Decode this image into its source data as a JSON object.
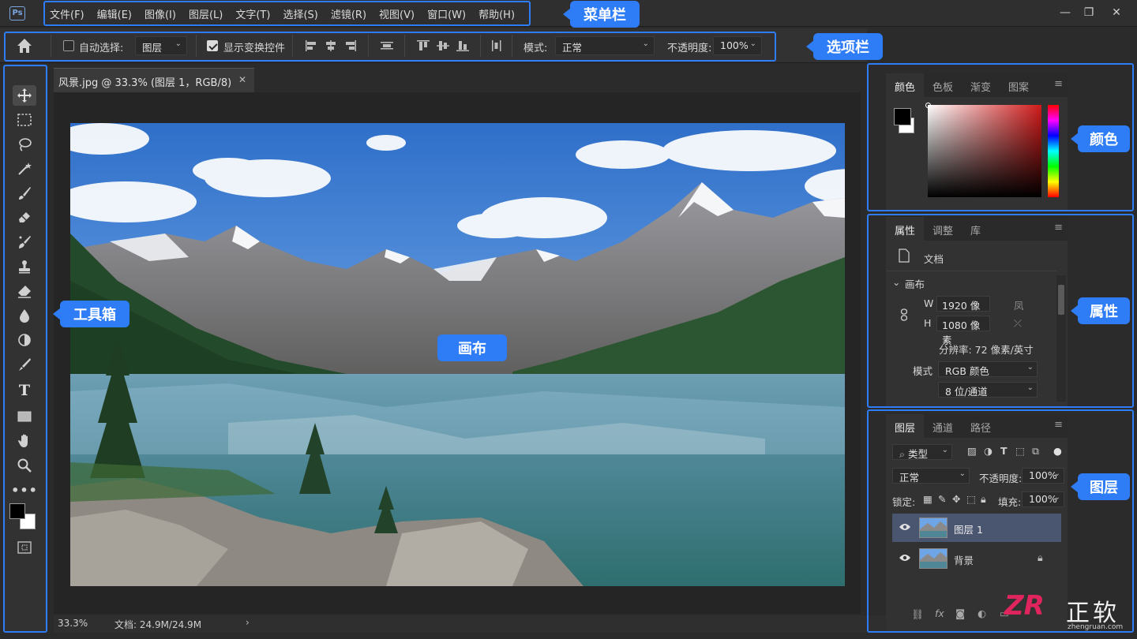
{
  "menubar": {
    "items": [
      "文件(F)",
      "编辑(E)",
      "图像(I)",
      "图层(L)",
      "文字(T)",
      "选择(S)",
      "滤镜(R)",
      "视图(V)",
      "窗口(W)",
      "帮助(H)"
    ]
  },
  "options": {
    "auto_select_label": "自动选择:",
    "auto_select_value": "图层",
    "show_transform_label": "显示变换控件",
    "mode_label": "模式:",
    "mode_value": "正常",
    "opacity_label": "不透明度:",
    "opacity_value": "100%"
  },
  "document": {
    "tab_title": "风景.jpg  @ 33.3% (图层 1，RGB/8)",
    "zoom": "33.3%",
    "doc_size": "文档: 24.9M/24.9M"
  },
  "color_panel": {
    "tabs": [
      "颜色",
      "色板",
      "渐变",
      "图案"
    ],
    "foreground": "#000000",
    "background": "#ffffff",
    "hue_color": "#d11a1a"
  },
  "properties_panel": {
    "tabs": [
      "属性",
      "调整",
      "库"
    ],
    "doc_label": "文档",
    "section_label": "画布",
    "w_label": "W",
    "w_value": "1920 像素",
    "h_label": "H",
    "h_value": "1080 像素",
    "resolution": "分辨率: 72 像素/英寸",
    "mode_label": "模式",
    "mode_value": "RGB 颜色",
    "depth_value": "8 位/通道"
  },
  "layers_panel": {
    "tabs": [
      "图层",
      "通道",
      "路径"
    ],
    "filter_label": "类型",
    "blend_value": "正常",
    "opacity_label": "不透明度:",
    "opacity_value": "100%",
    "lock_label": "锁定:",
    "fill_label": "填充:",
    "fill_value": "100%",
    "layers": [
      {
        "name": "图层 1"
      },
      {
        "name": "背景"
      }
    ]
  },
  "annotations": {
    "menubar": "菜单栏",
    "optionsbar": "选项栏",
    "toolbox": "工具箱",
    "canvas": "画布",
    "color": "颜色",
    "properties": "属性",
    "layers": "图层"
  },
  "colors": {
    "accent": "#2e7cf6",
    "panel_bg": "#323232",
    "app_bg": "#2b2b2b"
  },
  "watermark": {
    "logo": "ZR",
    "cn": "正软",
    "url": "zhengruan.com"
  }
}
